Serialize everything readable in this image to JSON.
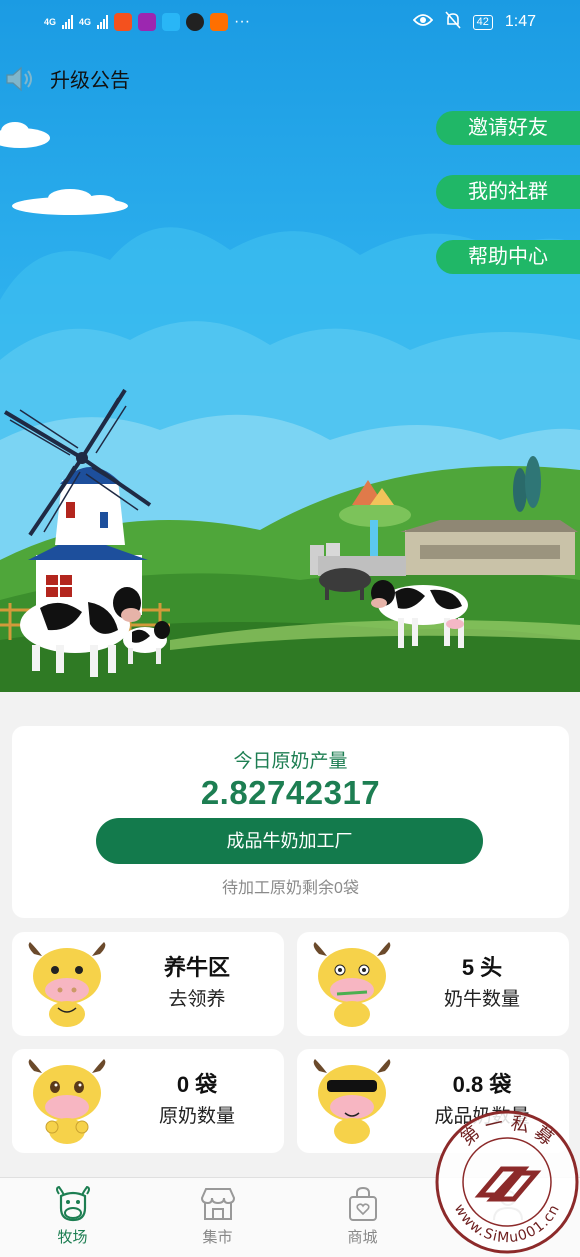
{
  "status_bar": {
    "network_1": "4G",
    "network_2": "4G",
    "battery": "42",
    "time": "1:47",
    "more": "···",
    "app_icons": [
      "#f4511e",
      "#9c27b0",
      "#29b6f6",
      "#212121",
      "#ff6f00"
    ]
  },
  "announcement": {
    "label": "升级公告",
    "icon": "speaker-icon"
  },
  "side_actions": {
    "invite": "邀请好友",
    "community": "我的社群",
    "help": "帮助中心"
  },
  "production": {
    "label": "今日原奶产量",
    "value": "2.82742317",
    "button": "成品牛奶加工厂",
    "note": "待加工原奶剩余0袋"
  },
  "tiles": {
    "ranch": {
      "title": "养牛区",
      "subtitle": "去领养"
    },
    "cows": {
      "title": "5 头",
      "subtitle": "奶牛数量"
    },
    "raw_milk": {
      "title": "0 袋",
      "subtitle": "原奶数量"
    },
    "finished_milk": {
      "title": "0.8 袋",
      "subtitle": "成品奶数量"
    }
  },
  "tabs": [
    {
      "label": "牧场",
      "icon": "cow-icon",
      "active": true
    },
    {
      "label": "集市",
      "icon": "market-icon",
      "active": false
    },
    {
      "label": "商城",
      "icon": "shopping-bag-icon",
      "active": false
    },
    {
      "label": "",
      "icon": "profile-icon",
      "active": false
    }
  ],
  "watermark": {
    "top_text": "第 一 私 募",
    "url": "www.SiMu001.cn"
  },
  "colors": {
    "brand_green": "#137a4c",
    "pill_green": "#20b767",
    "text_green": "#1d7e52",
    "sky": "#2eb1ee"
  }
}
